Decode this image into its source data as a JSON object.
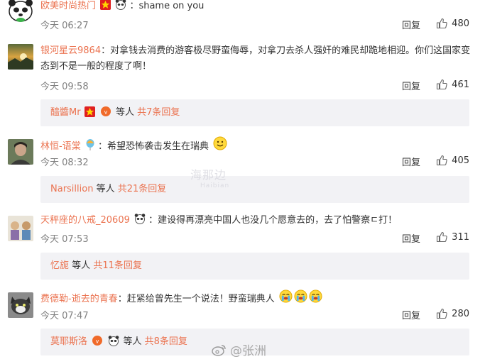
{
  "comments": [
    {
      "username": "欧美时尚热门",
      "text": "：shame on you",
      "time": "今天 06:27",
      "reply_label": "回复",
      "likes": "480",
      "avatar_icon": "panda-face-avatar"
    },
    {
      "username": "银河星云9864",
      "text": "：对拿钱去消费的游客极尽野蛮侮辱，对拿刀去杀人强奸的难民却跪地相迎。你们这国家变态到不是一般的程度了啊！",
      "time": "今天 09:58",
      "reply_label": "回复",
      "likes": "461",
      "avatar_icon": "sunset-landscape-avatar",
      "sub_reply": {
        "name": "醯醬Mr",
        "suffix": "等人",
        "more": "共7条回复"
      }
    },
    {
      "username": "林恒-语棠",
      "text": "：希望恐怖袭击发生在瑞典",
      "time": "今天 08:32",
      "reply_label": "回复",
      "likes": "405",
      "avatar_icon": "person-portrait-avatar",
      "sub_reply": {
        "name": "Narsillion",
        "suffix": "等人",
        "more": "共21条回复"
      }
    },
    {
      "username": "天秤座的八戒_20609",
      "text": "：建设得再漂亮中国人也没几个愿意去的，去了怕警察ㄷ打！",
      "time": "今天 07:53",
      "reply_label": "回复",
      "likes": "311",
      "avatar_icon": "cartoon-characters-avatar",
      "sub_reply": {
        "name": "忆旎",
        "suffix": "等人",
        "more": "共11条回复"
      }
    },
    {
      "username": "费德勒-逝去的青春",
      "text": "：赶紧给曾先生一个说法！野蛮瑞典人",
      "time": "今天 07:47",
      "reply_label": "回复",
      "likes": "280",
      "avatar_icon": "cat-avatar",
      "sub_reply": {
        "name": "莫耶斯洛",
        "suffix": "等人",
        "more": "共8条回复"
      }
    }
  ],
  "watermarks": {
    "center": "海那边",
    "center_sub": "Haibian",
    "weibo": "@张洲"
  },
  "colors": {
    "username": "#eb7350",
    "meta": "#808080",
    "sub_bg": "#f2f2f5"
  }
}
